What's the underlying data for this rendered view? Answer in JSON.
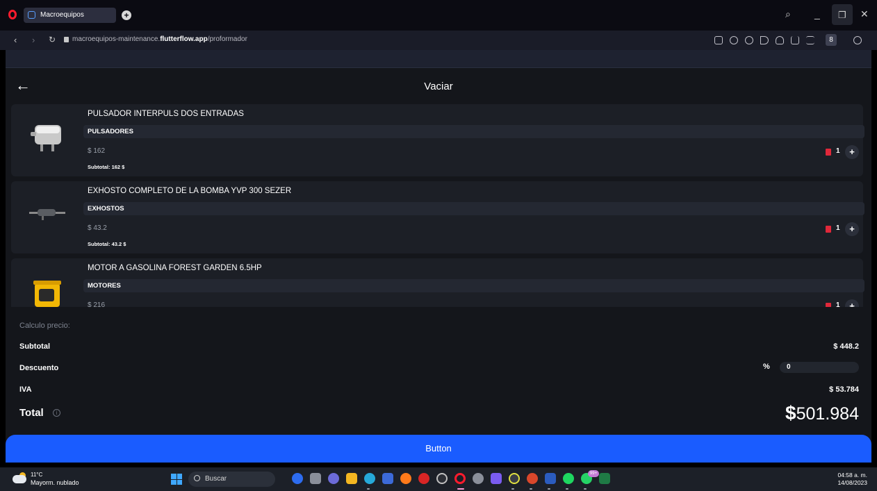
{
  "browser": {
    "tab_title": "Macroequipos",
    "url_prefix": "macroequipos-maintenance.",
    "url_domain": "flutterflow.app",
    "url_path": "/proformador",
    "profile_letter": "8"
  },
  "appbar": {
    "title": "Vaciar"
  },
  "products": [
    {
      "name": "PULSADOR INTERPULS DOS ENTRADAS",
      "category": "PULSADORES",
      "price": "$ 162",
      "subtotal": "Subtotal: 162 $",
      "qty": "1"
    },
    {
      "name": "EXHOSTO COMPLETO DE LA BOMBA YVP 300 SEZER",
      "category": "EXHOSTOS",
      "price": "$ 43.2",
      "subtotal": "Subtotal: 43.2 $",
      "qty": "1"
    },
    {
      "name": "MOTOR A GASOLINA FOREST GARDEN 6.5HP",
      "category": "MOTORES",
      "price": "$ 216",
      "subtotal": "",
      "qty": "1"
    }
  ],
  "calc": {
    "heading": "Calculo precio:",
    "subtotal_label": "Subtotal",
    "subtotal_value": "$ 448.2",
    "discount_label": "Descuento",
    "discount_value": "0",
    "iva_label": "IVA",
    "iva_value": "$ 53.784",
    "total_label": "Total",
    "total_currency": "$",
    "total_value": "501.984"
  },
  "button": {
    "label": "Button"
  },
  "taskbar": {
    "weather_temp": "11°C",
    "weather_desc": "Mayorm. nublado",
    "search_placeholder": "Buscar",
    "whatsapp_badge": "99+",
    "time": "04:58 a. m.",
    "date": "14/08/2023"
  },
  "colors": {
    "accent": "#1a5cff",
    "trash": "#e0283a",
    "background": "#14161b",
    "card": "#1c1f26"
  }
}
